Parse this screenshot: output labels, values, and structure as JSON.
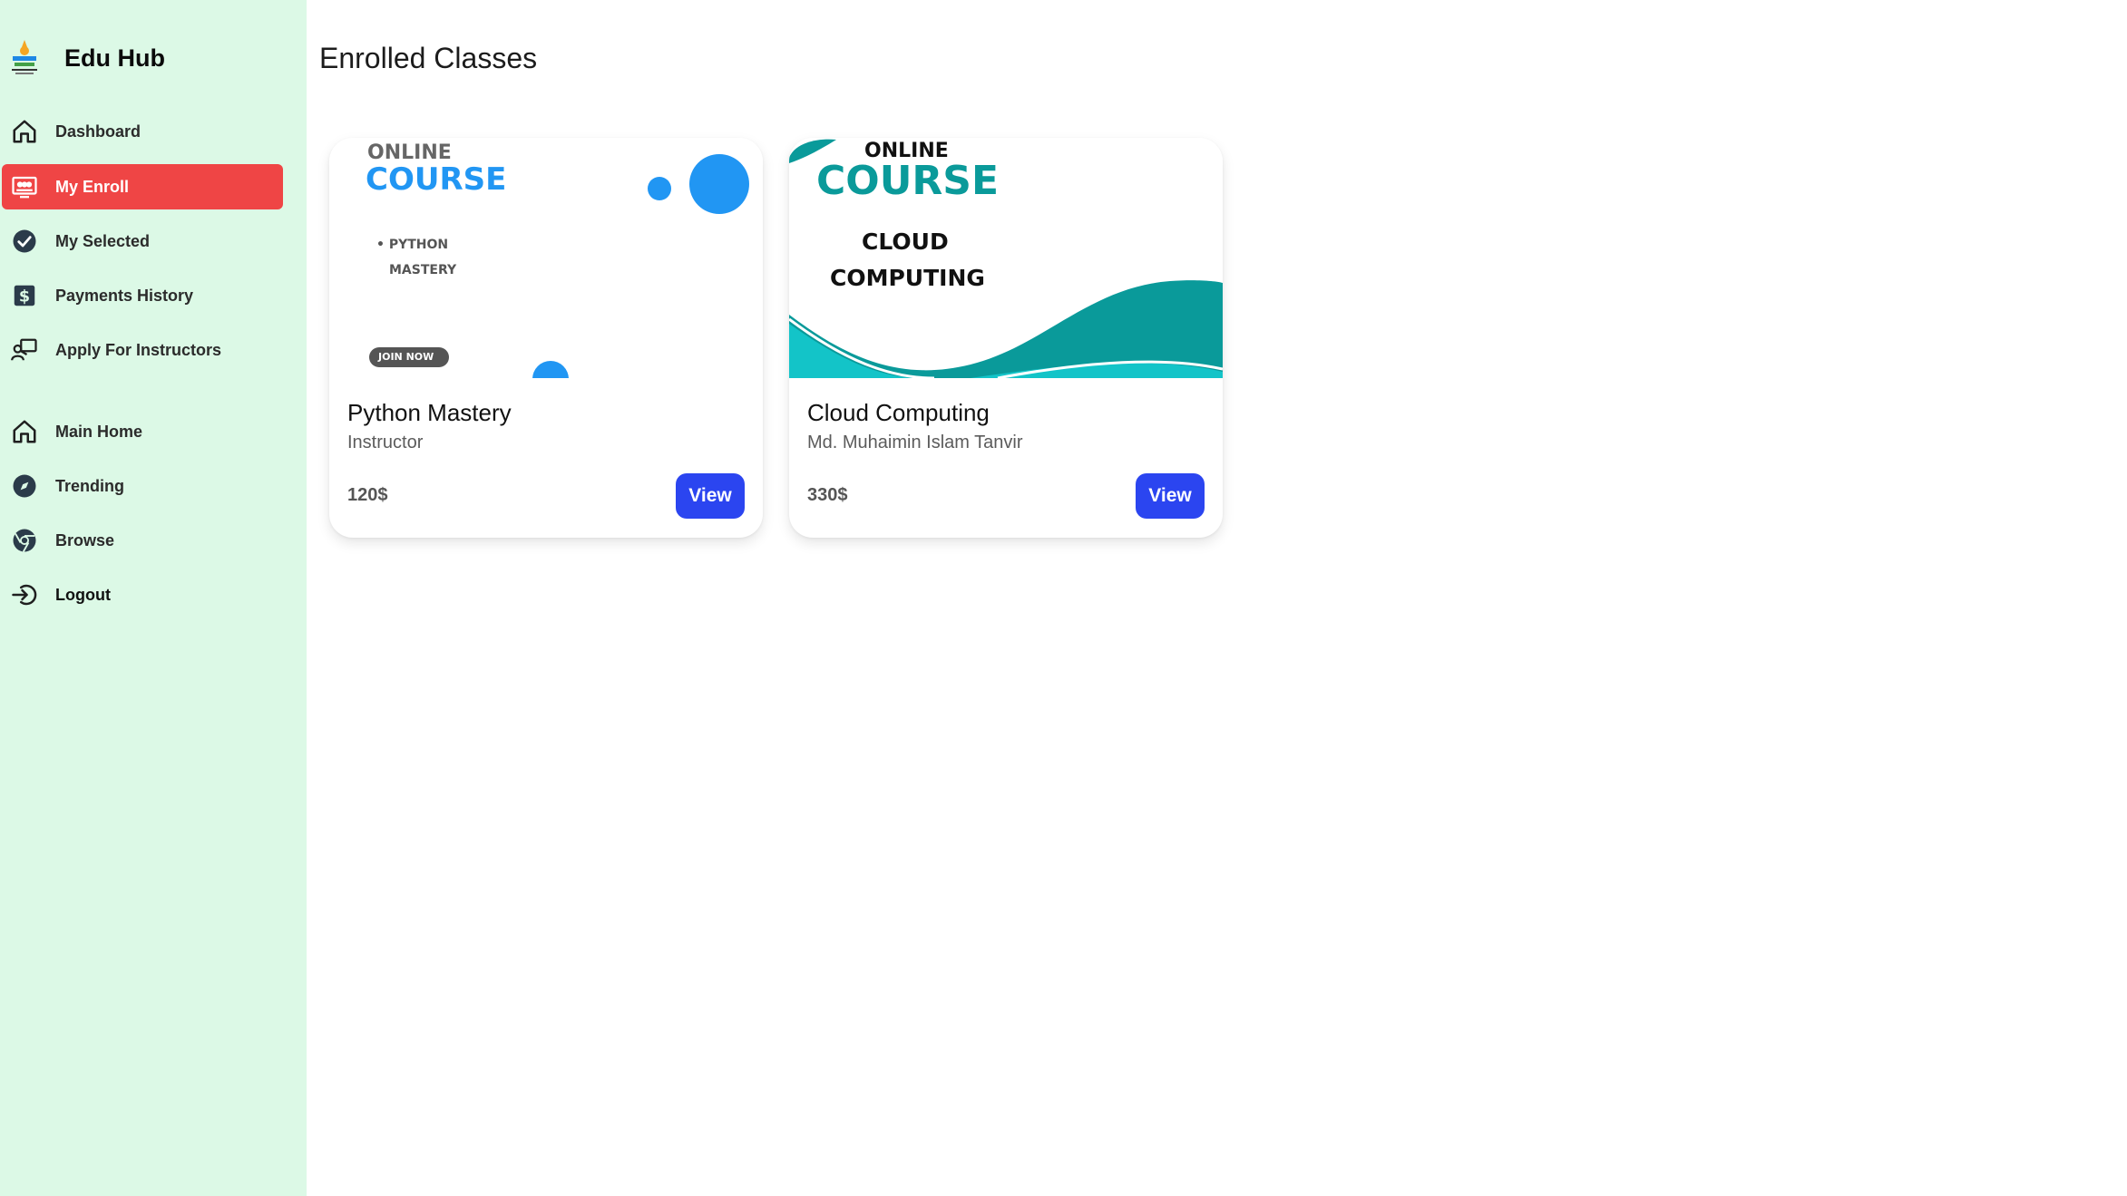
{
  "brand": {
    "name": "Edu Hub"
  },
  "sidebar": {
    "items": [
      {
        "label": "Dashboard",
        "icon": "home-icon"
      },
      {
        "label": "My Enroll",
        "icon": "enroll-board-icon",
        "active": true
      },
      {
        "label": "My Selected",
        "icon": "check-circle-icon"
      },
      {
        "label": "Payments History",
        "icon": "dollar-icon"
      },
      {
        "label": "Apply For Instructors",
        "icon": "instructor-icon"
      }
    ],
    "secondary": [
      {
        "label": "Main Home",
        "icon": "home-icon"
      },
      {
        "label": "Trending",
        "icon": "compass-icon"
      },
      {
        "label": "Browse",
        "icon": "browser-icon"
      },
      {
        "label": "Logout",
        "icon": "logout-icon"
      }
    ]
  },
  "main": {
    "title": "Enrolled Classes",
    "classes": [
      {
        "name": "Python Mastery",
        "instructor": "Instructor",
        "price": "120$",
        "view_label": "View",
        "thumb": {
          "line1": "ONLINE",
          "line2": "COURSE",
          "bullet1": "• PYTHON",
          "bullet2": "MASTERY",
          "badge": "JOIN NOW"
        }
      },
      {
        "name": "Cloud Computing",
        "instructor": "Md. Muhaimin Islam Tanvir",
        "price": "330$",
        "view_label": "View",
        "thumb": {
          "line1": "ONLINE",
          "line2": "COURSE",
          "sub1": "CLOUD",
          "sub2": "COMPUTING"
        }
      }
    ]
  },
  "colors": {
    "sidebar_bg": "#dcf9e6",
    "active": "#ef4545",
    "button": "#2b45f0",
    "teal": "#0a9a9a",
    "blue": "#2196f3"
  }
}
